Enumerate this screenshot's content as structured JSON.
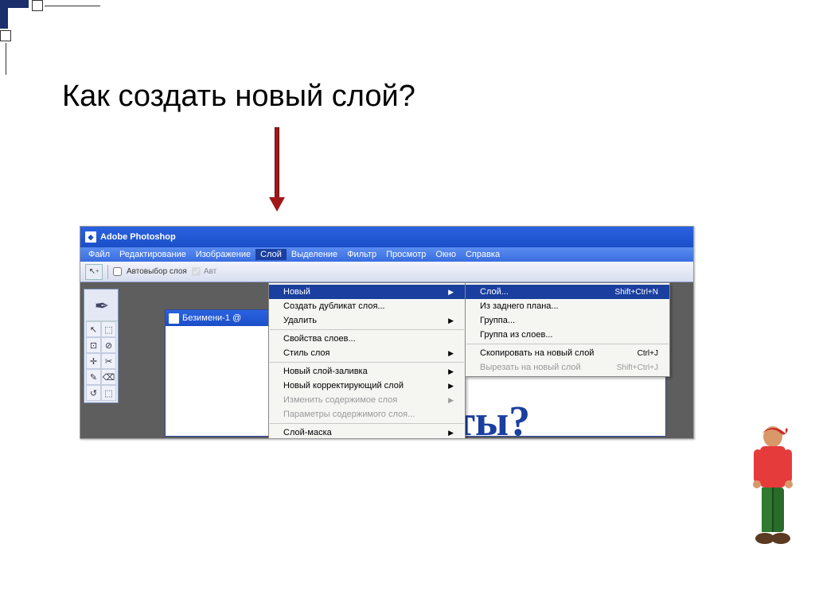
{
  "slide": {
    "title": "Как создать новый слой?"
  },
  "app": {
    "title": "Adobe Photoshop"
  },
  "menubar": {
    "items": [
      "Файл",
      "Редактирование",
      "Изображение",
      "Слой",
      "Выделение",
      "Фильтр",
      "Просмотр",
      "Окно",
      "Справка"
    ],
    "active_index": 3
  },
  "optbar": {
    "checkbox1_label": "Автовыбор слоя",
    "checkbox2_label": "Авт"
  },
  "doc": {
    "title": "Безимени-1 @"
  },
  "canvas": {
    "text": "фекты?"
  },
  "dropdown1": {
    "groups": [
      [
        {
          "label": "Новый",
          "sub": true,
          "highlight": true
        },
        {
          "label": "Создать дубликат слоя..."
        },
        {
          "label": "Удалить",
          "sub": true
        }
      ],
      [
        {
          "label": "Свойства слоев..."
        },
        {
          "label": "Стиль слоя",
          "sub": true
        }
      ],
      [
        {
          "label": "Новый слой-заливка",
          "sub": true
        },
        {
          "label": "Новый корректирующий слой",
          "sub": true
        },
        {
          "label": "Изменить содержимое слоя",
          "sub": true,
          "disabled": true
        },
        {
          "label": "Параметры содержимого слоя...",
          "disabled": true
        }
      ],
      [
        {
          "label": "Слой-маска",
          "sub": true
        }
      ]
    ]
  },
  "dropdown2": {
    "groups": [
      [
        {
          "label": "Слой...",
          "shortcut": "Shift+Ctrl+N",
          "highlight": true
        },
        {
          "label": "Из заднего плана..."
        },
        {
          "label": "Группа..."
        },
        {
          "label": "Группа из слоев..."
        }
      ],
      [
        {
          "label": "Скопировать на новый слой",
          "shortcut": "Ctrl+J"
        },
        {
          "label": "Вырезать на новый слой",
          "shortcut": "Shift+Ctrl+J",
          "disabled": true
        }
      ]
    ]
  },
  "tool_icons": [
    "↖",
    "⬚",
    "⊡",
    "⊘",
    "✛",
    "✂",
    "✎",
    "⌫",
    "↺",
    "⬚"
  ]
}
